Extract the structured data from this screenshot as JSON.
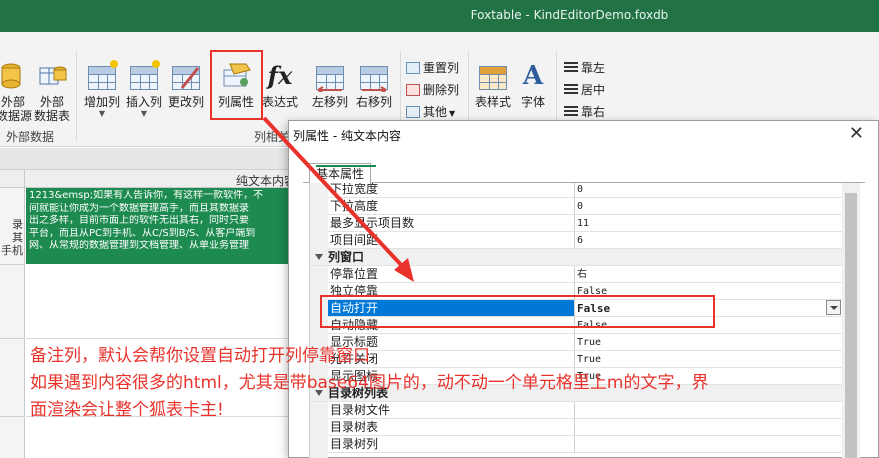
{
  "window": {
    "title": "Foxtable - KindEditorDemo.foxdb"
  },
  "ribbon": {
    "external_group": {
      "label": "外部数据",
      "btn_partial": {
        "line1": "外部",
        "line2": "数据源"
      },
      "btn_table": {
        "line1": "外部",
        "line2": "数据表"
      }
    },
    "col_group": {
      "label": "列相关",
      "add_col": "增加列",
      "insert_col": "插入列",
      "change_col": "更改列",
      "col_props": "列属性",
      "expression": "表达式",
      "expression_icon_text": "fx",
      "move_left": "左移列",
      "move_right": "右移列",
      "reset_col": "重置列",
      "delete_col": "删除列",
      "other": "其他",
      "table_style": "表样式",
      "font": "字体",
      "font_icon_text": "A",
      "align_left": "靠左",
      "align_center": "居中",
      "align_right": "靠右"
    }
  },
  "sheet": {
    "column_header": "纯文本内容",
    "row_text": [
      "录",
      "其",
      "手机"
    ],
    "cell_lines": [
      "1213&emsp;如果有人告诉你，有这样一款软件，不",
      "间就能让你成为一个数据管理高手，而且其数据录",
      "出之多样，目前市面上的软件无出其右，同时只要",
      "平台，而且从PC到手机、从C/S到B/S、从客户端到",
      "网、从常规的数据管理到文档管理、从单业务管理"
    ]
  },
  "dialog": {
    "title": "列属性 - 纯文本内容",
    "close": "✕",
    "tab": "基本属性",
    "rows": [
      {
        "name": "下拉宽度",
        "value": "0"
      },
      {
        "name": "下拉高度",
        "value": "0"
      },
      {
        "name": "最多显示项目数",
        "value": "11"
      },
      {
        "name": "项目间距",
        "value": "6"
      },
      {
        "category": "列窗口"
      },
      {
        "name": "停靠位置",
        "value": "右"
      },
      {
        "name": "独立停靠",
        "value": "False"
      },
      {
        "name": "自动打开",
        "value": "False",
        "selected": true
      },
      {
        "name": "自动隐藏",
        "value": "False"
      },
      {
        "name": "显示标题",
        "value": "True"
      },
      {
        "name": "允许关闭",
        "value": "True"
      },
      {
        "name": "显示图标",
        "value": "True"
      },
      {
        "category": "目录树列表"
      },
      {
        "name": "目录树文件",
        "value": ""
      },
      {
        "name": "目录树表",
        "value": ""
      },
      {
        "name": "目录树列",
        "value": ""
      }
    ]
  },
  "annotation": {
    "line1": "备注列，默认会帮你设置自动打开列停靠窗口",
    "line2": "如果遇到内容很多的html，尤其是带base64图片的，动不动一个单元格里上m的文字，界",
    "line3": "面渲染会让整个狐表卡主!"
  },
  "colors": {
    "titlebar": "#217346",
    "cell_fill": "#1d8a4f",
    "highlight": "#e8322b",
    "selection": "#0078d7"
  }
}
